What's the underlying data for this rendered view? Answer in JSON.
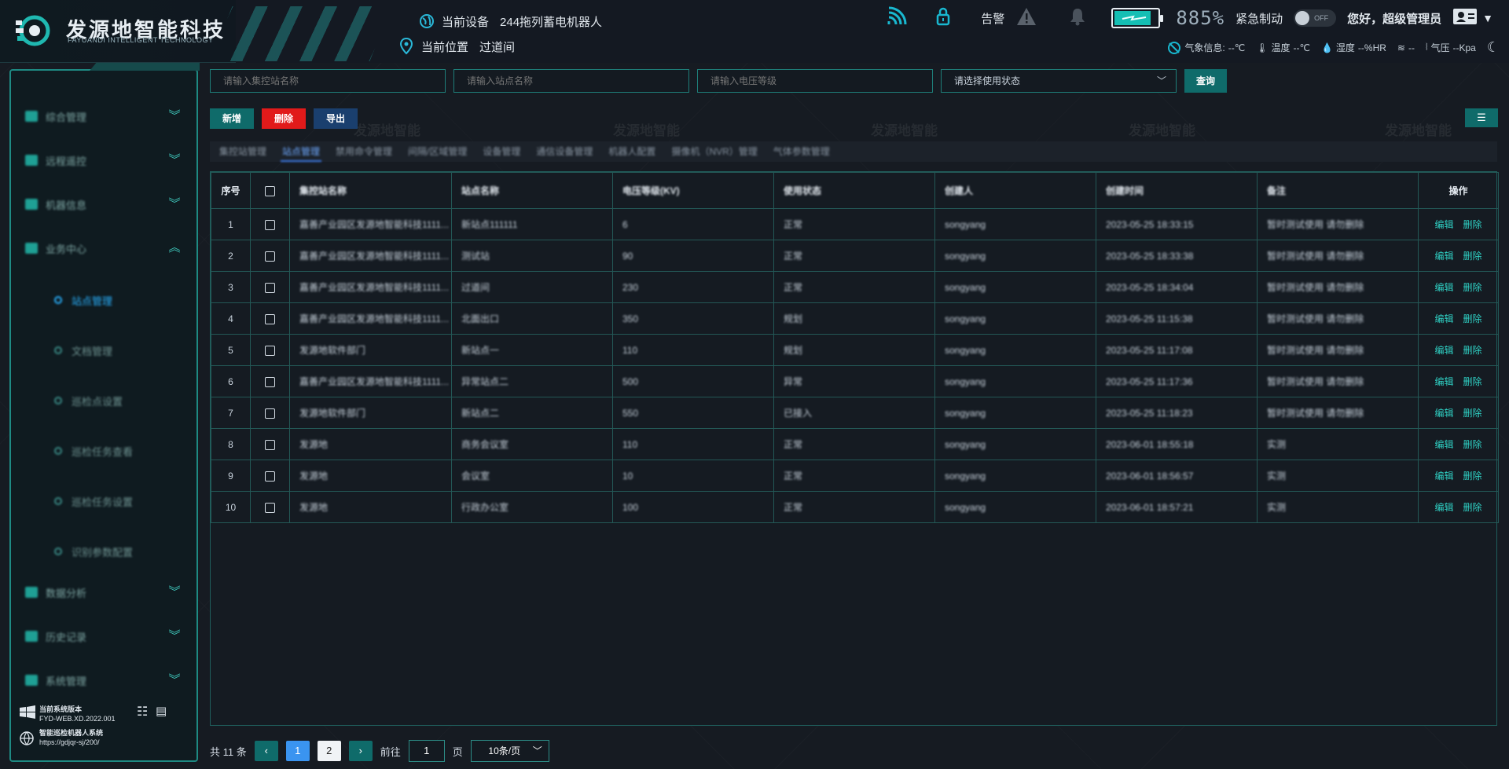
{
  "brand": {
    "name_cn": "发源地智能科技",
    "name_en": "FAYUANDI INTELLIGENT TECHNOLOGY"
  },
  "header": {
    "device_label": "当前设备",
    "device_value": "244拖列蓄电机器人",
    "location_label": "当前位置",
    "location_value": "过道间",
    "alarm_label": "告警",
    "battery_pct_text": "885%",
    "battery_level": 0.85,
    "emergency_label": "紧急制动",
    "toggle_text": "OFF",
    "greeting": "您好，超级管理员",
    "weather": {
      "label": "气象信息:",
      "temp": "--℃",
      "temp_label": "温度",
      "temp_value": "--℃",
      "humidity_label": "湿度",
      "humidity_value": "--%HR",
      "wind_value": "--",
      "pressure_label": "气压",
      "pressure_value": "--Kpa"
    }
  },
  "sidebar": {
    "items": [
      {
        "label": "综合管理"
      },
      {
        "label": "远程遥控"
      },
      {
        "label": "机器信息"
      },
      {
        "label": "业务中心"
      },
      {
        "label": "数据分析"
      },
      {
        "label": "历史记录"
      },
      {
        "label": "系统管理"
      }
    ],
    "sub_items": [
      {
        "label": "站点管理"
      },
      {
        "label": "文档管理"
      },
      {
        "label": "巡检点设置"
      },
      {
        "label": "巡检任务查看"
      },
      {
        "label": "巡检任务设置"
      },
      {
        "label": "识别参数配置"
      }
    ],
    "footer": {
      "version_title": "当前系统版本",
      "version": "FYD-WEB.XD.2022.001",
      "system_name": "智能巡检机器人系统",
      "url": "https://gdjqr-sj/200/"
    }
  },
  "filters": {
    "control_station_placeholder": "请输入集控站名称",
    "station_placeholder": "请输入站点名称",
    "voltage_placeholder": "请输入电压等级",
    "status_placeholder": "请选择使用状态",
    "query_label": "查询"
  },
  "actions": {
    "add": "新增",
    "delete": "删除",
    "export": "导出",
    "grid_icon": "☰"
  },
  "tabs": [
    "集控站管理",
    "站点管理",
    "禁用命令管理",
    "间隔/区域管理",
    "设备管理",
    "通信设备管理",
    "机器人配置",
    "摄像机（NVR）管理",
    "气体参数管理"
  ],
  "table": {
    "headers": [
      "序号",
      "",
      "集控站名称",
      "站点名称",
      "电压等级(KV)",
      "使用状态",
      "创建人",
      "创建时间",
      "备注",
      "操作"
    ],
    "rows": [
      {
        "no": "1",
        "ctrl": "嘉善产业园区发源地智能科技1111...",
        "station": "新站点111111",
        "voltage": "6",
        "status": "正常",
        "creator": "songyang",
        "time": "2023-05-25 18:33:15",
        "note": "暂时测试使用 请勿删除"
      },
      {
        "no": "2",
        "ctrl": "嘉善产业园区发源地智能科技1111...",
        "station": "测试站",
        "voltage": "90",
        "status": "正常",
        "creator": "songyang",
        "time": "2023-05-25 18:33:38",
        "note": "暂时测试使用 请勿删除"
      },
      {
        "no": "3",
        "ctrl": "嘉善产业园区发源地智能科技1111...",
        "station": "过道间",
        "voltage": "230",
        "status": "正常",
        "creator": "songyang",
        "time": "2023-05-25 18:34:04",
        "note": "暂时测试使用 请勿删除"
      },
      {
        "no": "4",
        "ctrl": "嘉善产业园区发源地智能科技1111...",
        "station": "北面出口",
        "voltage": "350",
        "status": "规划",
        "creator": "songyang",
        "time": "2023-05-25 11:15:38",
        "note": "暂时测试使用 请勿删除"
      },
      {
        "no": "5",
        "ctrl": "发源地软件部门",
        "station": "新站点一",
        "voltage": "110",
        "status": "规划",
        "creator": "songyang",
        "time": "2023-05-25 11:17:08",
        "note": "暂时测试使用 请勿删除"
      },
      {
        "no": "6",
        "ctrl": "嘉善产业园区发源地智能科技1111...",
        "station": "异常站点二",
        "voltage": "500",
        "status": "异常",
        "creator": "songyang",
        "time": "2023-05-25 11:17:36",
        "note": "暂时测试使用 请勿删除"
      },
      {
        "no": "7",
        "ctrl": "发源地软件部门",
        "station": "新站点二",
        "voltage": "550",
        "status": "已接入",
        "creator": "songyang",
        "time": "2023-05-25 11:18:23",
        "note": "暂时测试使用 请勿删除"
      },
      {
        "no": "8",
        "ctrl": "发源地",
        "station": "商务会议室",
        "voltage": "110",
        "status": "正常",
        "creator": "songyang",
        "time": "2023-06-01 18:55:18",
        "note": "实测"
      },
      {
        "no": "9",
        "ctrl": "发源地",
        "station": "会议室",
        "voltage": "10",
        "status": "正常",
        "creator": "songyang",
        "time": "2023-06-01 18:56:57",
        "note": "实测"
      },
      {
        "no": "10",
        "ctrl": "发源地",
        "station": "行政办公室",
        "voltage": "100",
        "status": "正常",
        "creator": "songyang",
        "time": "2023-06-01 18:57:21",
        "note": "实测"
      }
    ],
    "edit_label": "编辑",
    "delete_label": "删除"
  },
  "pagination": {
    "total_text": "共 11 条",
    "pages": [
      "1",
      "2"
    ],
    "goto_label": "前往",
    "goto_value": "1",
    "page_suffix": "页",
    "page_size": "10条/页"
  },
  "watermark": "发源地智能"
}
